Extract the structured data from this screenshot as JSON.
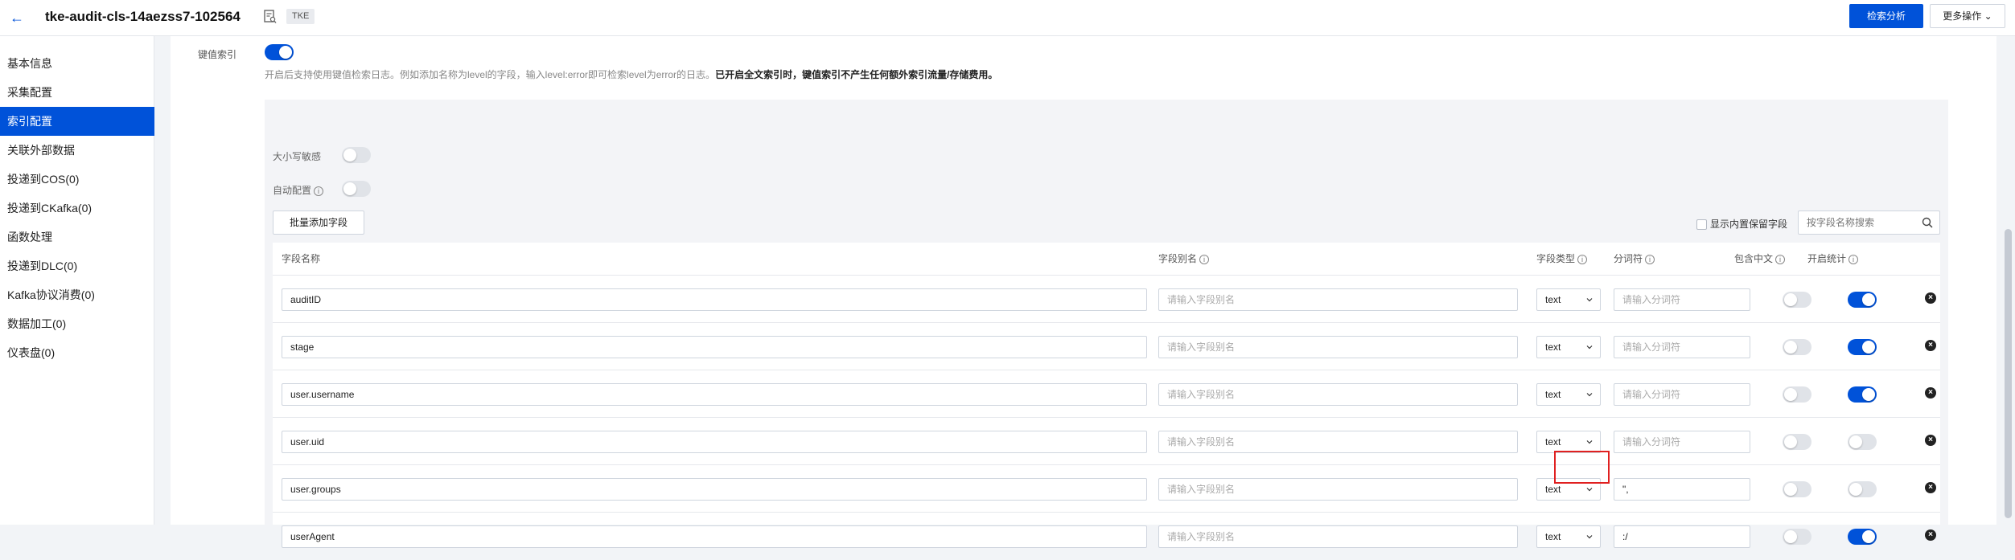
{
  "header": {
    "title": "tke-audit-cls-14aezss7-102564",
    "tag": "TKE",
    "primary_button": "检索分析",
    "more_button": "更多操作"
  },
  "sidebar": {
    "items": [
      {
        "label": "基本信息"
      },
      {
        "label": "采集配置"
      },
      {
        "label": "索引配置",
        "active": true
      },
      {
        "label": "关联外部数据"
      },
      {
        "label": "投递到COS(0)"
      },
      {
        "label": "投递到CKafka(0)"
      },
      {
        "label": "函数处理"
      },
      {
        "label": "投递到DLC(0)"
      },
      {
        "label": "Kafka协议消费(0)"
      },
      {
        "label": "数据加工(0)"
      },
      {
        "label": "仪表盘(0)"
      }
    ]
  },
  "kv_index": {
    "label": "键值索引",
    "enabled": true,
    "description": "开启后支持使用键值检索日志。例如添加名称为level的字段，输入level:error即可检索level为error的日志。",
    "description_bold": "已开启全文索引时，键值索引不产生任何额外索引流量/存储费用。"
  },
  "options": {
    "case_sensitive_label": "大小写敏感",
    "case_sensitive": false,
    "auto_config_label": "自动配置",
    "auto_config": false,
    "batch_add_button": "批量添加字段",
    "show_builtin_label": "显示内置保留字段",
    "search_placeholder": "按字段名称搜索"
  },
  "table": {
    "columns": {
      "name": "字段名称",
      "alias": "字段别名",
      "type": "字段类型",
      "tokenizer": "分词符",
      "chinese": "包含中文",
      "stats": "开启统计"
    },
    "alias_placeholder": "请输入字段别名",
    "tokenizer_placeholder": "请输入分词符",
    "rows": [
      {
        "name": "auditID",
        "type": "text",
        "tokenizer": "",
        "chinese": false,
        "stats": true
      },
      {
        "name": "stage",
        "type": "text",
        "tokenizer": "",
        "chinese": false,
        "stats": true
      },
      {
        "name": "user.username",
        "type": "text",
        "tokenizer": "",
        "chinese": false,
        "stats": true
      },
      {
        "name": "user.uid",
        "type": "text",
        "tokenizer": "",
        "chinese": false,
        "stats": false
      },
      {
        "name": "user.groups",
        "type": "text",
        "tokenizer": "\",",
        "chinese": false,
        "stats": false
      },
      {
        "name": "userAgent",
        "type": "text",
        "tokenizer": ":/",
        "chinese": false,
        "stats": true
      }
    ]
  },
  "colors": {
    "primary": "#0052d9",
    "highlight_border": "#e02020"
  }
}
